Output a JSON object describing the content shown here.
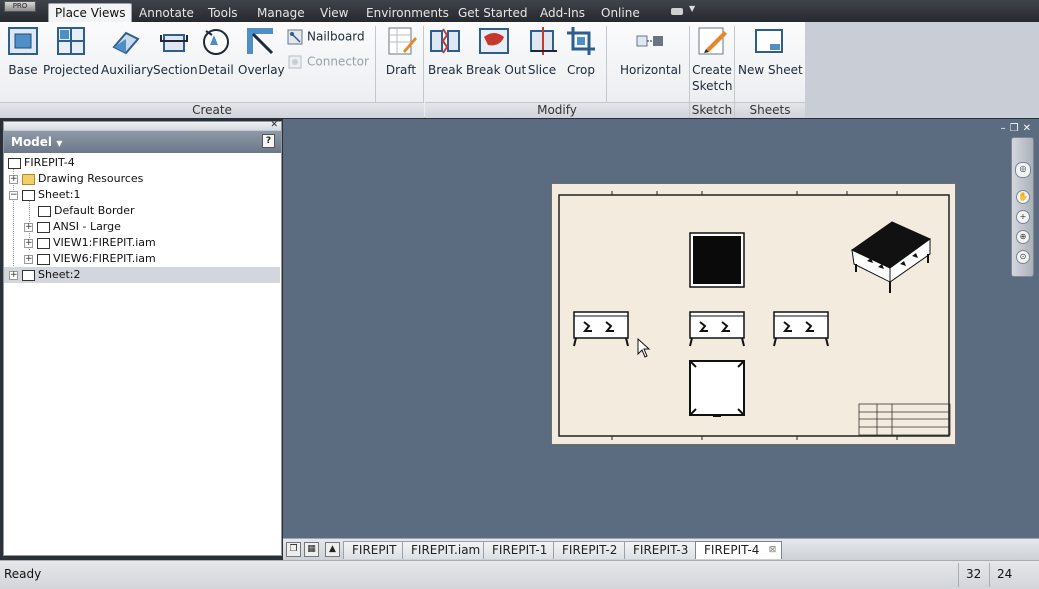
{
  "app": {
    "badge": "PRO"
  },
  "menu_tabs": [
    "Place Views",
    "Annotate",
    "Tools",
    "Manage",
    "View",
    "Environments",
    "Get Started",
    "Add-Ins",
    "Online"
  ],
  "ribbon": {
    "create": {
      "title": "Create",
      "tools": [
        "Base",
        "Projected",
        "Auxiliary",
        "Section",
        "Detail",
        "Overlay"
      ],
      "nailboard": "Nailboard",
      "connector": "Connector"
    },
    "draft": "Draft",
    "modify": {
      "title": "Modify",
      "tools": [
        "Break",
        "Break Out",
        "Slice",
        "Crop"
      ],
      "horizontal": "Horizontal"
    },
    "sketch": {
      "title": "Sketch",
      "create_line1": "Create",
      "create_line2": "Sketch"
    },
    "sheets": {
      "title": "Sheets",
      "new_sheet": "New Sheet"
    }
  },
  "model_browser": {
    "title": "Model",
    "help": "?",
    "tree": [
      {
        "label": "FIREPIT-4",
        "level": 0,
        "icon": "drawing-icon"
      },
      {
        "label": "Drawing Resources",
        "level": 1,
        "icon": "folder-icon"
      },
      {
        "label": "Sheet:1",
        "level": 1,
        "icon": "sheet-icon"
      },
      {
        "label": "Default Border",
        "level": 2,
        "icon": "border-icon"
      },
      {
        "label": "ANSI - Large",
        "level": 2,
        "icon": "titleblock-icon"
      },
      {
        "label": "VIEW1:FIREPIT.iam",
        "level": 2,
        "icon": "view-icon"
      },
      {
        "label": "VIEW6:FIREPIT.iam",
        "level": 2,
        "icon": "view-icon"
      },
      {
        "label": "Sheet:2",
        "level": 1,
        "icon": "sheet-icon",
        "selected": true
      }
    ]
  },
  "doc_tabs": [
    "FIREPIT",
    "FIREPIT.iam",
    "FIREPIT-1",
    "FIREPIT-2",
    "FIREPIT-3",
    "FIREPIT-4"
  ],
  "active_doc": "FIREPIT-4",
  "status": {
    "text": "Ready",
    "count1": "32",
    "count2": "24"
  },
  "colors": {
    "canvas": "#5b6b80",
    "sheet": "#f3ebde",
    "ribbon_active_tab": "#f3f4f6"
  }
}
